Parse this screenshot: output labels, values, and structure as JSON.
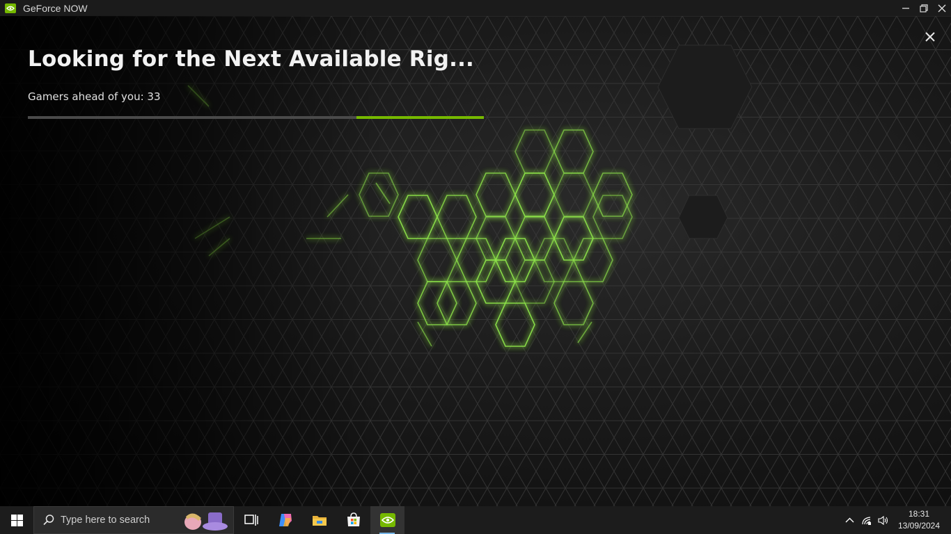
{
  "window": {
    "title": "GeForce NOW",
    "brand_color": "#76b900"
  },
  "queue": {
    "headline": "Looking for the Next Available Rig...",
    "status": "Gamers ahead of you: 33",
    "progress_fraction": 0.28
  },
  "taskbar": {
    "search_placeholder": "Type here to search",
    "pinned": [
      "task-view-icon",
      "copilot-icon",
      "file-explorer-icon",
      "microsoft-store-icon",
      "geforce-now-icon"
    ],
    "clock": {
      "time": "18:31",
      "date": "13/09/2024"
    }
  }
}
